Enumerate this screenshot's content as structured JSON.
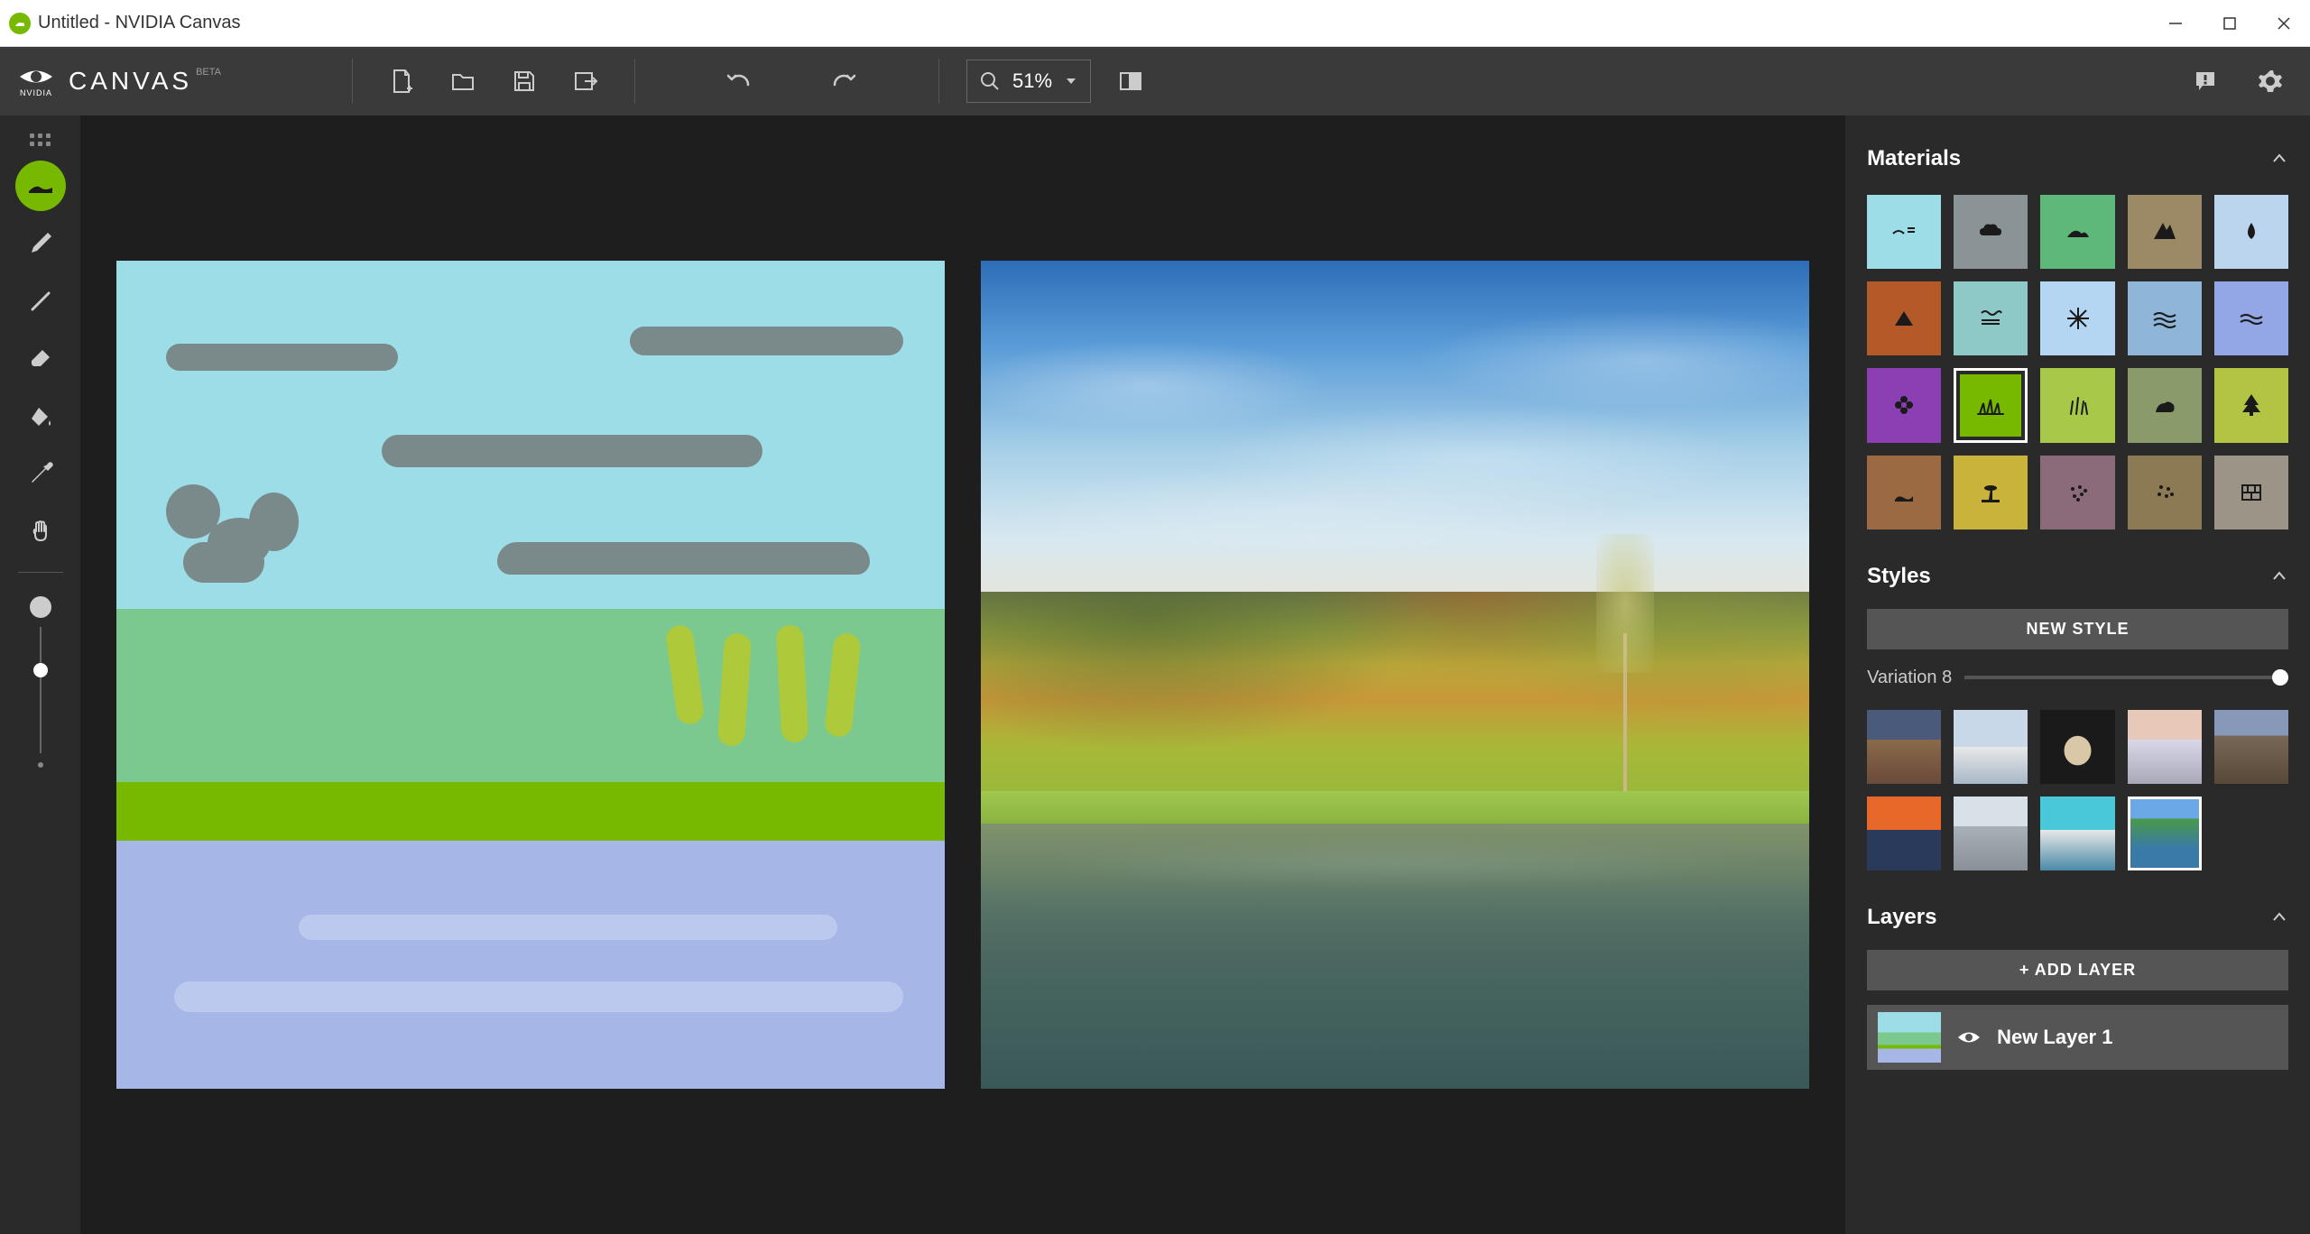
{
  "titlebar": {
    "title": "Untitled - NVIDIA Canvas"
  },
  "branding": {
    "logo_sub": "NVIDIA",
    "app_name": "CANVAS",
    "beta": "BETA"
  },
  "toolbar": {
    "zoom_value": "51%"
  },
  "panels": {
    "materials_title": "Materials",
    "styles_title": "Styles",
    "new_style_label": "NEW STYLE",
    "variation_label": "Variation 8",
    "layers_title": "Layers",
    "add_layer_label": "+ ADD LAYER"
  },
  "materials": [
    {
      "name": "sky",
      "color": "#9DDDE8",
      "icon": "sky"
    },
    {
      "name": "cloud",
      "color": "#8a9496",
      "icon": "cloud"
    },
    {
      "name": "hill",
      "color": "#5eb87a",
      "icon": "hill"
    },
    {
      "name": "mountain",
      "color": "#9c8a66",
      "icon": "mountain"
    },
    {
      "name": "water",
      "color": "#bcd5ef",
      "icon": "drop"
    },
    {
      "name": "dirt",
      "color": "#b35a28",
      "icon": "dirt"
    },
    {
      "name": "fog",
      "color": "#8fc9c7",
      "icon": "fog"
    },
    {
      "name": "snow",
      "color": "#b4d6f2",
      "icon": "snow"
    },
    {
      "name": "sea",
      "color": "#8fb5d8",
      "icon": "sea"
    },
    {
      "name": "river",
      "color": "#93a6e6",
      "icon": "river"
    },
    {
      "name": "flower",
      "color": "#8b3fb3",
      "icon": "flower"
    },
    {
      "name": "grass",
      "color": "#76b900",
      "icon": "grass",
      "selected": true
    },
    {
      "name": "bush",
      "color": "#a8c84a",
      "icon": "bush"
    },
    {
      "name": "rock",
      "color": "#8b9a6b",
      "icon": "rock"
    },
    {
      "name": "tree",
      "color": "#b3c444",
      "icon": "tree"
    },
    {
      "name": "mud",
      "color": "#9b6a42",
      "icon": "mud"
    },
    {
      "name": "sand",
      "color": "#c9b33a",
      "icon": "sand"
    },
    {
      "name": "gravel",
      "color": "#8b6b7a",
      "icon": "gravel"
    },
    {
      "name": "stone",
      "color": "#8b7a54",
      "icon": "stone"
    },
    {
      "name": "wall",
      "color": "#9c9486",
      "icon": "wall"
    }
  ],
  "style_thumbs": [
    {
      "name": "style-1",
      "bg": "linear-gradient(180deg,#4a5a7a 40%,#8a6a4a 40%,#6a4a3a 100%)"
    },
    {
      "name": "style-2",
      "bg": "linear-gradient(180deg,#c8d8e8 50%,#e8e8e8 50%,#a8b8c8 100%)"
    },
    {
      "name": "style-3",
      "bg": "radial-gradient(ellipse at 50% 55%,#d8c8a8 25%,#1a1a1a 26%)"
    },
    {
      "name": "style-4",
      "bg": "linear-gradient(180deg,#e8c8b8 40%,#d8d8e8 40%,#a8a8b8 100%)"
    },
    {
      "name": "style-5",
      "bg": "linear-gradient(180deg,#8898b8 35%,#786858 35%,#584838 100%)"
    },
    {
      "name": "style-6",
      "bg": "linear-gradient(180deg,#e8682a 45%,#2a3a5a 45%)"
    },
    {
      "name": "style-7",
      "bg": "linear-gradient(180deg,#d8e0e8 40%,#a8b0b8 40%,#8a9098 100%)"
    },
    {
      "name": "style-8",
      "bg": "linear-gradient(180deg,#48c8d8 45%,#e8e8e8 45%,#4a8aa8 100%)"
    },
    {
      "name": "style-9",
      "bg": "linear-gradient(180deg,#6aa8e8 30%,#4a9a4a 30%,#3a7aa8 70%)",
      "selected": true
    }
  ],
  "layers": [
    {
      "name": "New Layer 1"
    }
  ]
}
